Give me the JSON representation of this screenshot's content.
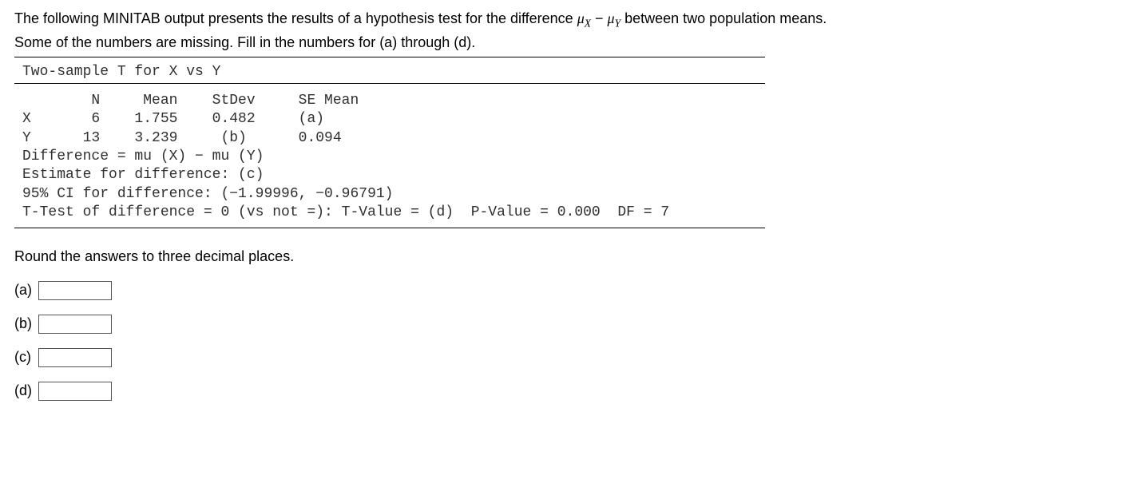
{
  "intro": {
    "line1_pre": "The following MINITAB output presents the results of a hypothesis test for the difference ",
    "mu_x": "μ",
    "sub_x": "X",
    "minus": " − ",
    "mu_y": "μ",
    "sub_y": "Y",
    "line1_post": " between two population means.",
    "line2": "Some of the numbers are missing. Fill in the numbers for (a) through (d)."
  },
  "minitab": {
    "title": "Two-sample T for X vs Y",
    "body": "        N     Mean    StDev     SE Mean\nX       6    1.755    0.482     (a)\nY      13    3.239     (b)      0.094\nDifference = mu (X) − mu (Y)\nEstimate for difference: (c)\n95% CI for difference: (−1.99996, −0.96791)\nT-Test of difference = 0 (vs not =): T-Value = (d)  P-Value = 0.000  DF = 7"
  },
  "instructions": "Round the answers to three decimal places.",
  "answers": {
    "a": {
      "label": "(a)",
      "value": ""
    },
    "b": {
      "label": "(b)",
      "value": ""
    },
    "c": {
      "label": "(c)",
      "value": ""
    },
    "d": {
      "label": "(d)",
      "value": ""
    }
  },
  "chart_data": {
    "type": "table",
    "title": "Two-sample T for X vs Y",
    "columns": [
      "",
      "N",
      "Mean",
      "StDev",
      "SE Mean"
    ],
    "rows": [
      [
        "X",
        6,
        1.755,
        0.482,
        "(a)"
      ],
      [
        "Y",
        13,
        3.239,
        "(b)",
        0.094
      ]
    ],
    "difference": "mu (X) − mu (Y)",
    "estimate_for_difference": "(c)",
    "ci_95": [
      -1.99996,
      -0.96791
    ],
    "t_test_null": 0,
    "alternative": "not =",
    "t_value": "(d)",
    "p_value": 0.0,
    "df": 7
  }
}
